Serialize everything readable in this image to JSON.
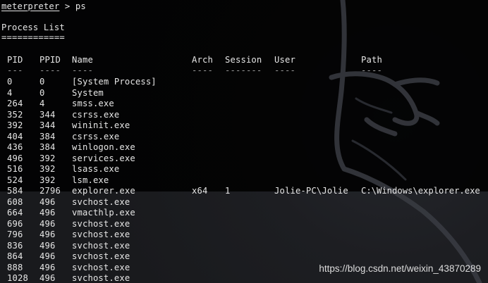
{
  "prompt": {
    "name": "meterpreter",
    "separator": " > ",
    "command": "ps"
  },
  "title": "Process List",
  "title_rule": "============",
  "columns": {
    "pid": "PID",
    "ppid": "PPID",
    "name": "Name",
    "arch": "Arch",
    "session": "Session",
    "user": "User",
    "path": "Path"
  },
  "dashes": {
    "pid": "---",
    "ppid": "----",
    "name": "----",
    "arch": "----",
    "session": "-------",
    "user": "----",
    "path": "----"
  },
  "rows": [
    {
      "pid": "0",
      "ppid": "0",
      "name": "[System Process]",
      "arch": "",
      "session": "",
      "user": "",
      "path": ""
    },
    {
      "pid": "4",
      "ppid": "0",
      "name": "System",
      "arch": "",
      "session": "",
      "user": "",
      "path": ""
    },
    {
      "pid": "264",
      "ppid": "4",
      "name": "smss.exe",
      "arch": "",
      "session": "",
      "user": "",
      "path": ""
    },
    {
      "pid": "352",
      "ppid": "344",
      "name": "csrss.exe",
      "arch": "",
      "session": "",
      "user": "",
      "path": ""
    },
    {
      "pid": "392",
      "ppid": "344",
      "name": "wininit.exe",
      "arch": "",
      "session": "",
      "user": "",
      "path": ""
    },
    {
      "pid": "404",
      "ppid": "384",
      "name": "csrss.exe",
      "arch": "",
      "session": "",
      "user": "",
      "path": ""
    },
    {
      "pid": "436",
      "ppid": "384",
      "name": "winlogon.exe",
      "arch": "",
      "session": "",
      "user": "",
      "path": ""
    },
    {
      "pid": "496",
      "ppid": "392",
      "name": "services.exe",
      "arch": "",
      "session": "",
      "user": "",
      "path": ""
    },
    {
      "pid": "516",
      "ppid": "392",
      "name": "lsass.exe",
      "arch": "",
      "session": "",
      "user": "",
      "path": ""
    },
    {
      "pid": "524",
      "ppid": "392",
      "name": "lsm.exe",
      "arch": "",
      "session": "",
      "user": "",
      "path": ""
    },
    {
      "pid": "584",
      "ppid": "2796",
      "name": "explorer.exe",
      "arch": "x64",
      "session": "1",
      "user": "Jolie-PC\\Jolie",
      "path": "C:\\Windows\\explorer.exe"
    },
    {
      "pid": "608",
      "ppid": "496",
      "name": "svchost.exe",
      "arch": "",
      "session": "",
      "user": "",
      "path": ""
    },
    {
      "pid": "664",
      "ppid": "496",
      "name": "vmacthlp.exe",
      "arch": "",
      "session": "",
      "user": "",
      "path": ""
    },
    {
      "pid": "696",
      "ppid": "496",
      "name": "svchost.exe",
      "arch": "",
      "session": "",
      "user": "",
      "path": ""
    },
    {
      "pid": "796",
      "ppid": "496",
      "name": "svchost.exe",
      "arch": "",
      "session": "",
      "user": "",
      "path": ""
    },
    {
      "pid": "836",
      "ppid": "496",
      "name": "svchost.exe",
      "arch": "",
      "session": "",
      "user": "",
      "path": ""
    },
    {
      "pid": "864",
      "ppid": "496",
      "name": "svchost.exe",
      "arch": "",
      "session": "",
      "user": "",
      "path": ""
    },
    {
      "pid": "888",
      "ppid": "496",
      "name": "svchost.exe",
      "arch": "",
      "session": "",
      "user": "",
      "path": ""
    },
    {
      "pid": "1028",
      "ppid": "496",
      "name": "svchost.exe",
      "arch": "",
      "session": "",
      "user": "",
      "path": ""
    }
  ],
  "watermark": "https://blog.csdn.net/weixin_43870289",
  "colors": {
    "text": "#e6e6e6",
    "background": "#1b1c20"
  },
  "icons": {
    "background_logo": "kali-dragon-icon"
  }
}
